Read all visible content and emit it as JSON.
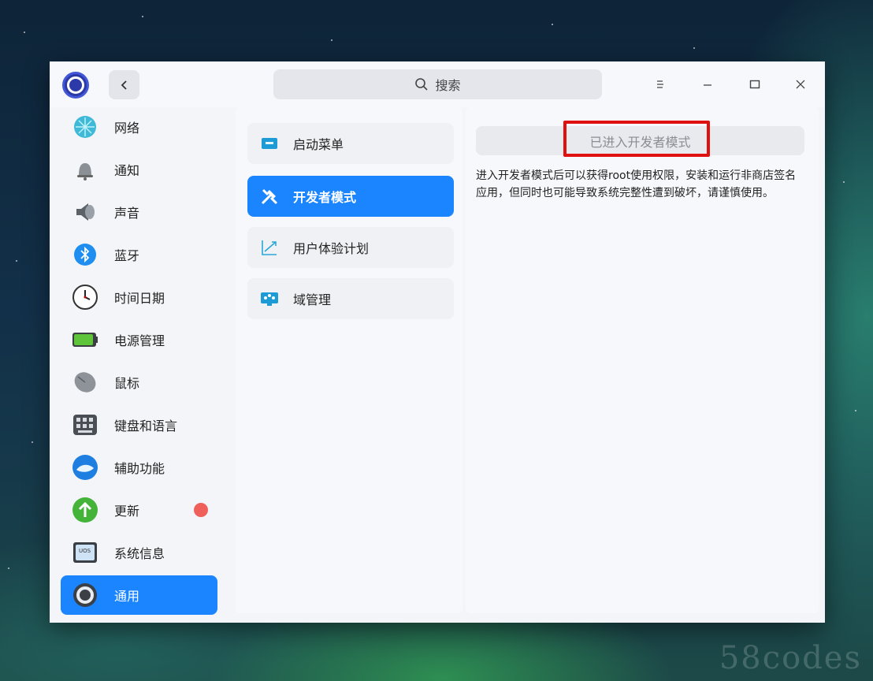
{
  "titlebar": {
    "search_label": "搜索"
  },
  "sidebar": {
    "items": [
      {
        "label": "网络",
        "icon": "network-icon"
      },
      {
        "label": "通知",
        "icon": "bell-icon"
      },
      {
        "label": "声音",
        "icon": "speaker-icon"
      },
      {
        "label": "蓝牙",
        "icon": "bluetooth-icon"
      },
      {
        "label": "时间日期",
        "icon": "clock-icon"
      },
      {
        "label": "电源管理",
        "icon": "battery-icon"
      },
      {
        "label": "鼠标",
        "icon": "mouse-icon"
      },
      {
        "label": "键盘和语言",
        "icon": "keyboard-icon"
      },
      {
        "label": "辅助功能",
        "icon": "accessibility-icon"
      },
      {
        "label": "更新",
        "icon": "update-icon",
        "has_badge": true
      },
      {
        "label": "系统信息",
        "icon": "system-info-icon"
      },
      {
        "label": "通用",
        "icon": "general-settings-icon",
        "active": true
      }
    ]
  },
  "submenu": {
    "items": [
      {
        "label": "启动菜单",
        "icon": "boot-menu-icon"
      },
      {
        "label": "开发者模式",
        "icon": "developer-tools-icon",
        "active": true
      },
      {
        "label": "用户体验计划",
        "icon": "trend-chart-icon"
      },
      {
        "label": "域管理",
        "icon": "domain-management-icon"
      }
    ]
  },
  "content": {
    "dev_mode_button": "已进入开发者模式",
    "description": "进入开发者模式后可以获得root使用权限，安装和运行非商店签名应用，但同时也可能导致系统完整性遭到破坏，请谨慎使用。"
  },
  "watermark": "58codes",
  "colors": {
    "accent": "#1a85ff",
    "badge": "#f0605a",
    "highlight_border": "#e01010"
  }
}
